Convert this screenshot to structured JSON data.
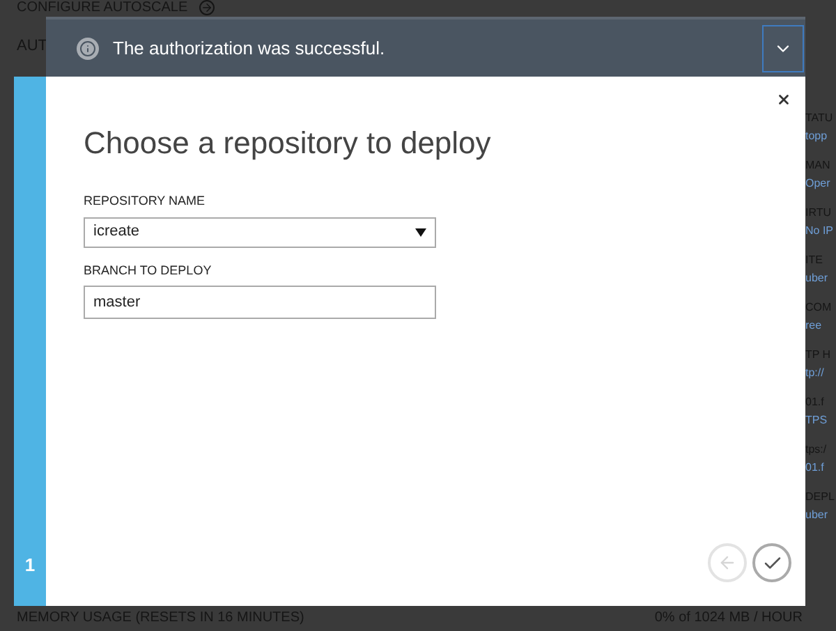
{
  "background": {
    "top_link": "CONFIGURE AUTOSCALE",
    "second_row": "AUT",
    "right_fragments": [
      "TATU",
      "topp",
      "MAN",
      "Oper",
      "IRTU",
      "No IP",
      "ITE",
      "uber",
      "COM",
      "ree",
      "TP H",
      "tp://",
      "01.f",
      "TPS",
      "tps:/",
      "01.f",
      "DEPL",
      "uber"
    ],
    "bottom_label": "MEMORY USAGE (RESETS IN 16 MINUTES)",
    "bottom_value": "0% of 1024 MB / HOUR"
  },
  "notification": {
    "message": "The authorization was successful.",
    "expanded": false
  },
  "dialog": {
    "step": "1",
    "title": "Choose a repository to deploy",
    "fields": [
      {
        "kind": "select",
        "label": "REPOSITORY NAME",
        "value": "icreate"
      },
      {
        "kind": "text",
        "label": "BRANCH TO DEPLOY",
        "value": "master"
      }
    ],
    "back_disabled": true
  }
}
